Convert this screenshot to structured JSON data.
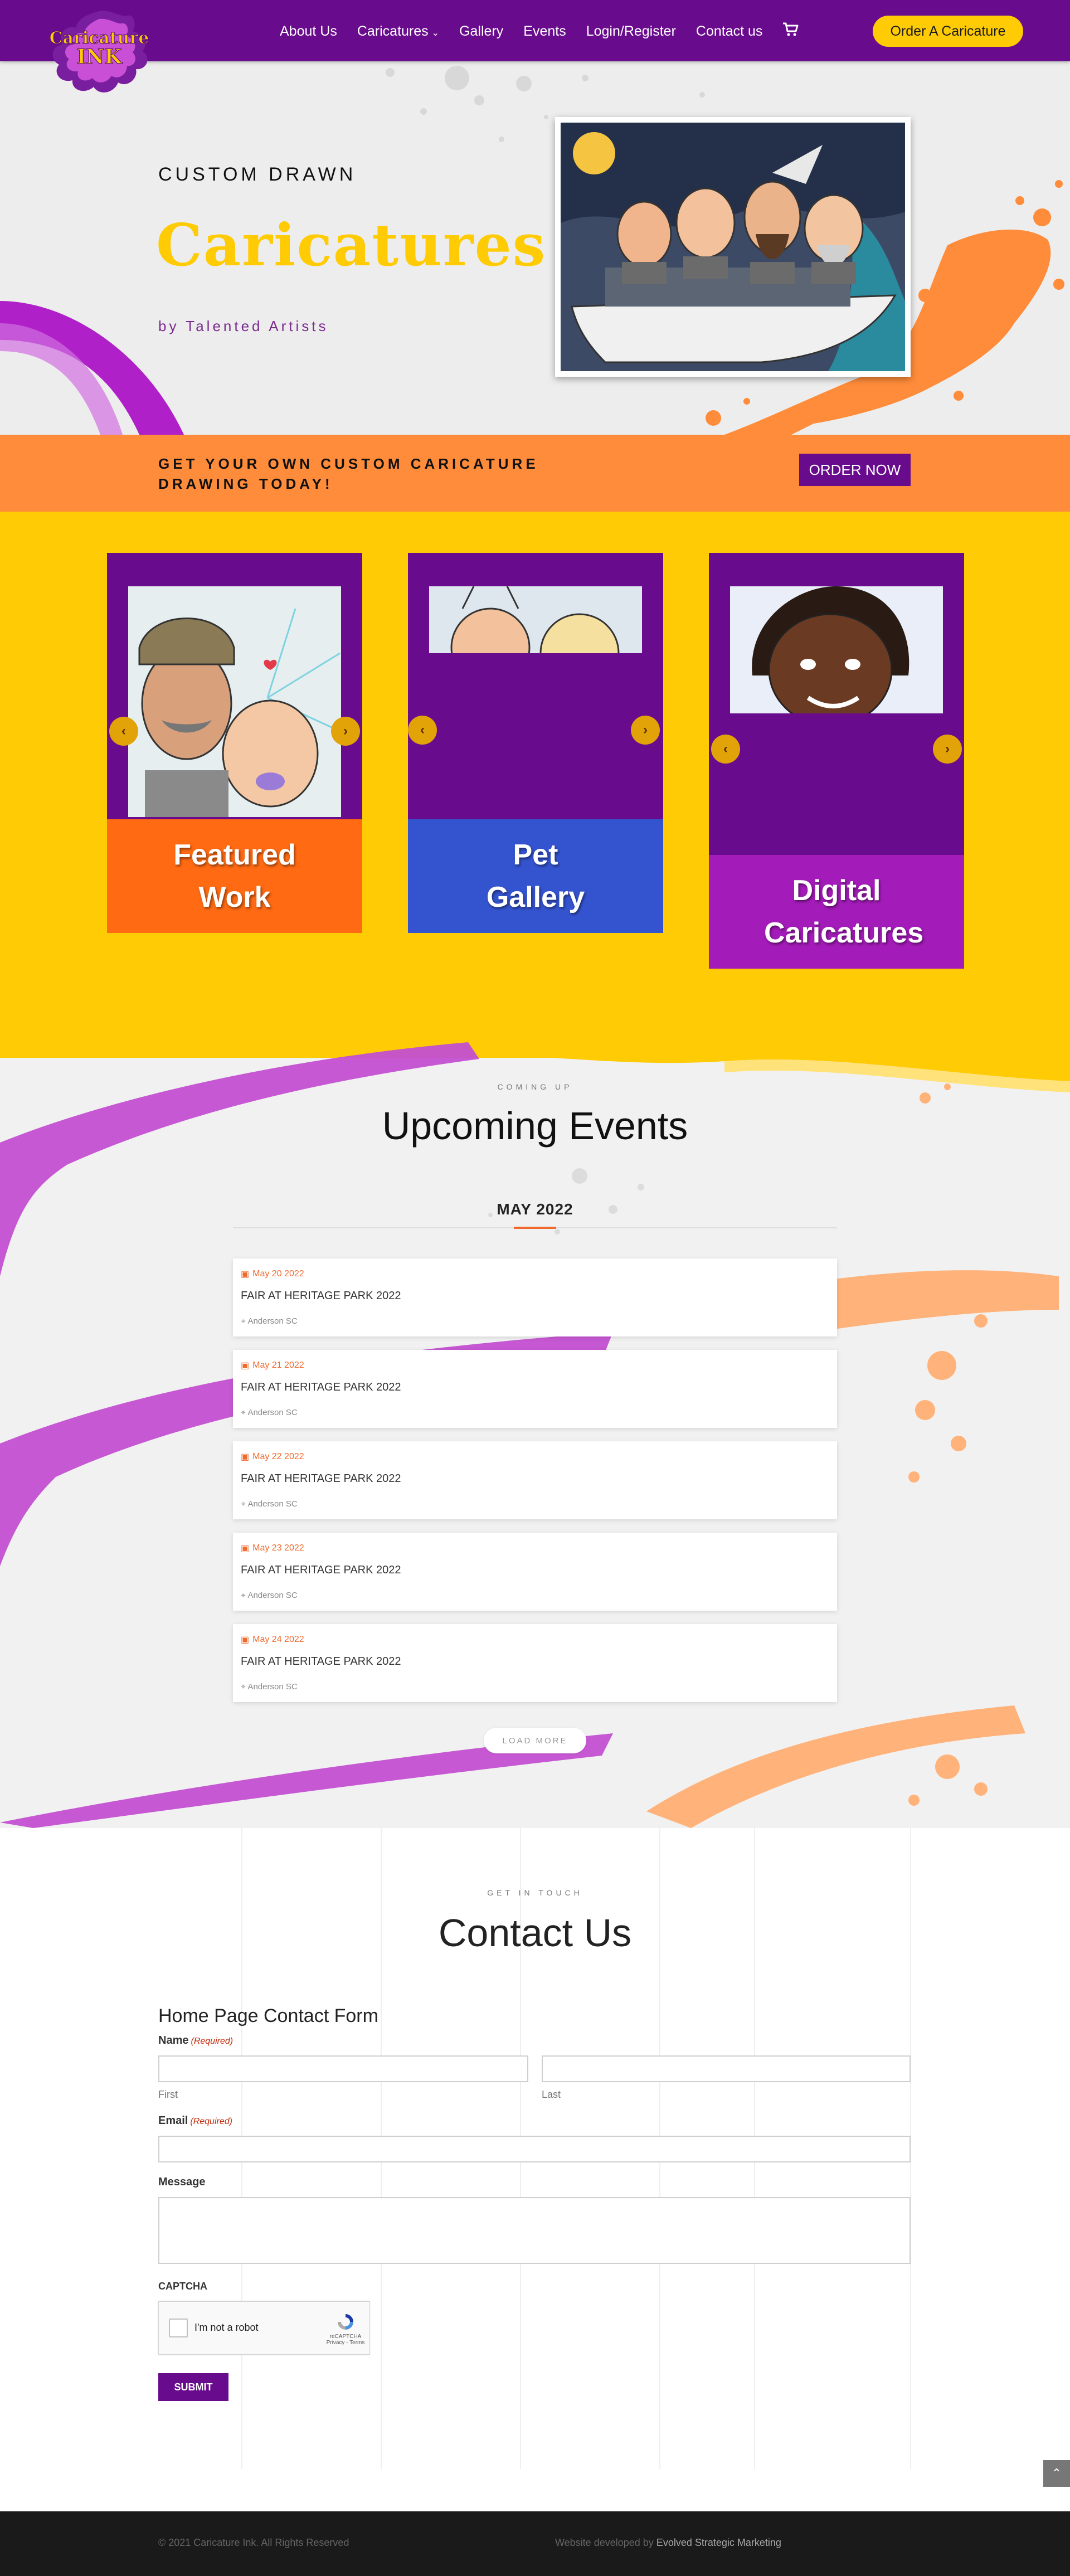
{
  "brand": {
    "logo_text_line1": "Caricature",
    "logo_text_line2": "INK",
    "accent_purple": "#690b8d",
    "accent_yellow": "#ffcb05",
    "accent_orange": "#ff8c3a"
  },
  "nav": {
    "items": [
      {
        "label": "About Us"
      },
      {
        "label": "Caricatures"
      },
      {
        "label": "Gallery"
      },
      {
        "label": "Events"
      },
      {
        "label": "Login/Register"
      },
      {
        "label": "Contact us"
      }
    ],
    "cart_icon": "shopping-cart-icon",
    "order_button": "Order A Caricature"
  },
  "hero": {
    "kicker": "CUSTOM DRAWN",
    "title": "Caricatures",
    "subtitle": "by Talented Artists"
  },
  "cta": {
    "text": "GET YOUR OWN CUSTOM CARICATURE DRAWING TODAY!",
    "button": "ORDER NOW"
  },
  "cards": [
    {
      "label": "Featured Work",
      "color": "#ff6a13"
    },
    {
      "label": "Pet Gallery",
      "color": "#3453cf"
    },
    {
      "label": "Digital Caricatures",
      "color": "#a31bb8"
    }
  ],
  "events": {
    "kicker": "COMING UP",
    "title": "Upcoming Events",
    "month": "MAY 2022",
    "items": [
      {
        "date": "May 20 2022",
        "name": "FAIR AT HERITAGE PARK 2022",
        "location": "Anderson SC"
      },
      {
        "date": "May 21 2022",
        "name": "FAIR AT HERITAGE PARK 2022",
        "location": "Anderson SC"
      },
      {
        "date": "May 22 2022",
        "name": "FAIR AT HERITAGE PARK 2022",
        "location": "Anderson SC"
      },
      {
        "date": "May 23 2022",
        "name": "FAIR AT HERITAGE PARK 2022",
        "location": "Anderson SC"
      },
      {
        "date": "May 24 2022",
        "name": "FAIR AT HERITAGE PARK 2022",
        "location": "Anderson SC"
      }
    ],
    "load_more": "LOAD MORE"
  },
  "contact": {
    "kicker": "GET IN TOUCH",
    "title": "Contact Us",
    "form_title": "Home Page Contact Form",
    "name_label": "Name",
    "required": "(Required)",
    "first_label": "First",
    "last_label": "Last",
    "email_label": "Email",
    "message_label": "Message",
    "captcha_label": "CAPTCHA",
    "captcha_text": "I'm not a robot",
    "captcha_brand": "reCAPTCHA",
    "captcha_links": "Privacy - Terms",
    "submit": "SUBMIT"
  },
  "footer": {
    "copyright": "© 2021 Caricature Ink. All Rights Reserved",
    "developed_prefix": "Website developed by",
    "developer": "Evolved Strategic Marketing"
  }
}
